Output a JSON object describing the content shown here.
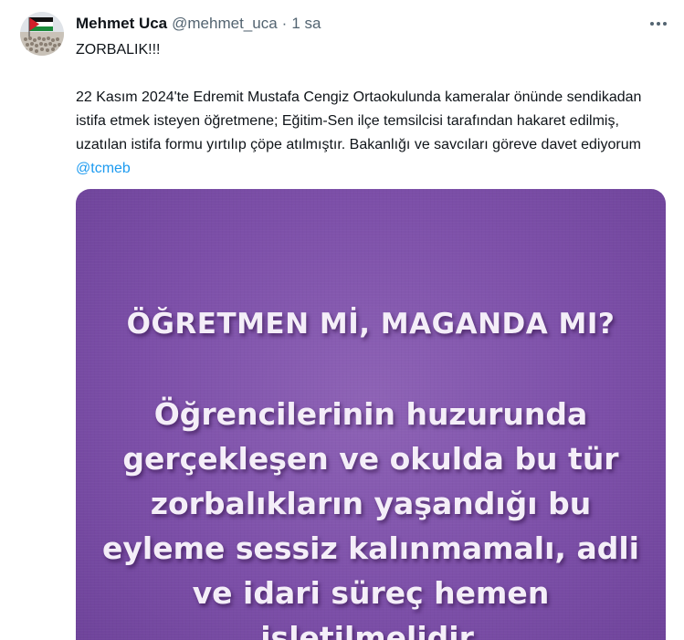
{
  "tweet": {
    "author_name": "Mehmet Uca",
    "author_handle": "@mehmet_uca",
    "separator": "·",
    "time": "1 sa",
    "more_icon": "more-horizontal-icon",
    "text_line1": "ZORBALIK!!!",
    "text_body": "22 Kasım 2024'te Edremit Mustafa Cengiz Ortaokulunda kameralar önünde sendikadan istifa etmek isteyen öğretmene; Eğitim-Sen ilçe temsilcisi tarafından hakaret edilmiş, uzatılan istifa formu yırtılıp çöpe atılmıştır. Bakanlığı ve savcıları göreve davet ediyorum",
    "mention": "@tcmeb",
    "mention_color": "#1d9bf0"
  },
  "media": {
    "heading": "ÖĞRETMEN Mİ, MAGANDA MI?",
    "body": "Öğrencilerinin huzurunda gerçekleşen ve okulda bu tür zorbalıkların yaşandığı bu eyleme sessiz kalınmamalı, adli ve idari süreç hemen işletilmelidir.",
    "background_color": "#7c4fa8"
  }
}
